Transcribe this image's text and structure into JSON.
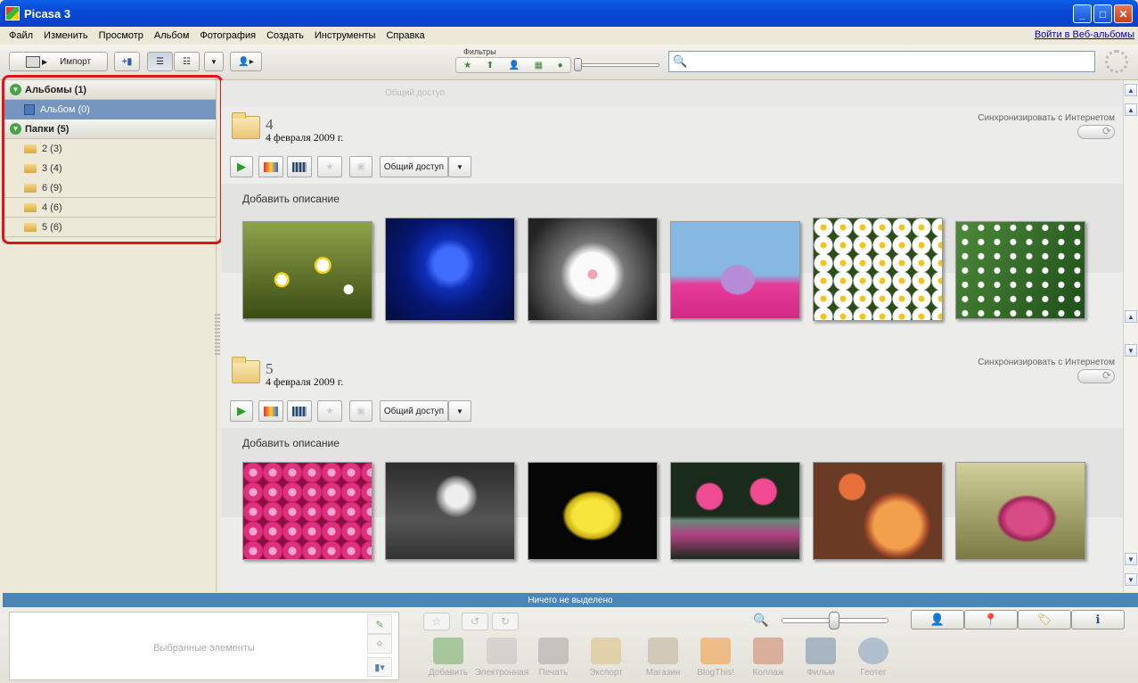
{
  "window": {
    "title": "Picasa 3"
  },
  "menu": {
    "items": [
      "Файл",
      "Изменить",
      "Просмотр",
      "Альбом",
      "Фотография",
      "Создать",
      "Инструменты",
      "Справка"
    ],
    "web_link": "Войти в Веб-альбомы"
  },
  "toolbar": {
    "import_label": "Импорт",
    "filters_label": "Фильтры",
    "search": {
      "value": "",
      "placeholder": ""
    }
  },
  "left_panel": {
    "albums_header": "Альбомы (1)",
    "albums": [
      {
        "label": "Альбом (0)",
        "selected": true
      }
    ],
    "folders_header": "Папки (5)",
    "folders": [
      {
        "label": "2 (3)"
      },
      {
        "label": "3 (4)"
      },
      {
        "label": "6 (9)"
      },
      {
        "label": "4 (6)"
      },
      {
        "label": "5 (6)"
      }
    ]
  },
  "main": {
    "ghost_share": "Общий доступ",
    "folders": [
      {
        "name": "4",
        "date": "4 февраля 2009 г.",
        "sync_label": "Синхронизировать с Интернетом",
        "share_label": "Общий доступ",
        "caption": "Добавить описание",
        "photos": [
          "chamomile-field",
          "blue-rose",
          "daisy-in-hand",
          "pink-hydrangea",
          "white-daisies",
          "lily-of-the-valley"
        ]
      },
      {
        "name": "5",
        "date": "4 февраля 2009 г.",
        "sync_label": "Синхронизировать с Интернетом",
        "share_label": "Общий доступ",
        "caption": "Добавить описание",
        "photos": [
          "pink-chrysanthemums",
          "dandelion",
          "yellow-lily",
          "water-lilies",
          "iris-butterfly",
          "pink-lotus"
        ]
      }
    ]
  },
  "status": {
    "text": "Ничего не выделено"
  },
  "tray": {
    "selected_label": "Выбранные элементы",
    "actions": [
      {
        "label": "Добавить",
        "icon": "upload-icon"
      },
      {
        "label": "Электронная почта",
        "icon": "email-icon"
      },
      {
        "label": "Печать",
        "icon": "print-icon"
      },
      {
        "label": "Экспорт",
        "icon": "export-icon"
      },
      {
        "label": "Магазин",
        "icon": "shop-icon"
      },
      {
        "label": "BlogThis!",
        "icon": "blogger-icon"
      },
      {
        "label": "Коллаж",
        "icon": "collage-icon"
      },
      {
        "label": "Фильм",
        "icon": "film-icon"
      },
      {
        "label": "Геотег",
        "icon": "globe-icon"
      }
    ]
  },
  "colors": {
    "accent": "#7595bf",
    "status_bar": "#4a86b6",
    "highlight_box": "#e0141a"
  }
}
